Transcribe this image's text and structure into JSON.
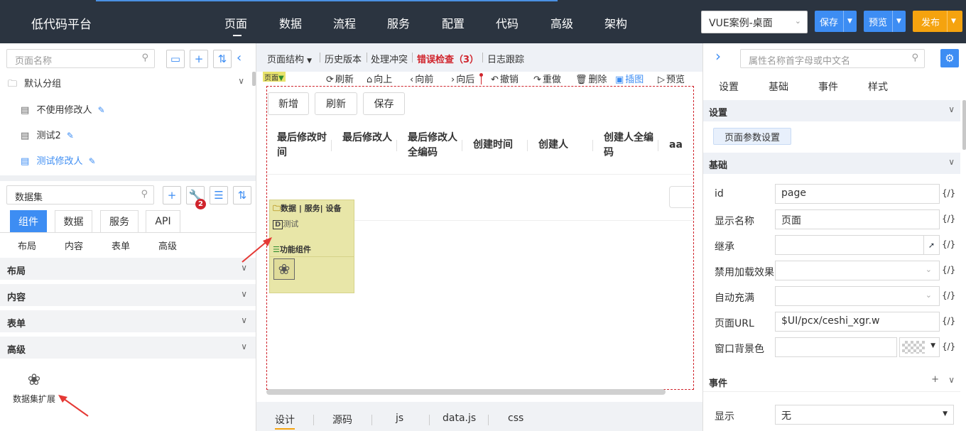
{
  "app": {
    "title": "低代码平台",
    "nav": [
      "页面",
      "数据",
      "流程",
      "服务",
      "配置",
      "代码",
      "高级",
      "架构"
    ],
    "project": "VUE案例-桌面",
    "save": "保存",
    "preview": "预览",
    "publish": "发布"
  },
  "left": {
    "page_search_placeholder": "页面名称",
    "group": "默认分组",
    "pages": [
      "不使用修改人",
      "测试2",
      "测试修改人"
    ],
    "component_search": "数据集",
    "badge": "2",
    "tabs": [
      "组件",
      "数据",
      "服务",
      "API"
    ],
    "subtabs": [
      "布局",
      "内容",
      "表单",
      "高级"
    ],
    "sections": [
      "布局",
      "内容",
      "表单",
      "高级"
    ],
    "extension_label": "数据集扩展"
  },
  "center": {
    "toolbar": [
      "页面结构",
      "历史版本",
      "处理冲突",
      "错误检查（3）",
      "日志跟踪"
    ],
    "page_tag": "页面",
    "actions": [
      "刷新",
      "向上",
      "向前",
      "向后",
      "撤销",
      "重做",
      "删除",
      "插图",
      "预览"
    ],
    "buttons": [
      "新增",
      "刷新",
      "保存"
    ],
    "columns": [
      "最后修改时间",
      "最后修改人",
      "最后修改人全编码",
      "创建时间",
      "创建人",
      "创建人全编码",
      "aa"
    ],
    "popup": {
      "header": "数据 | 服务| 设备",
      "item": "测试",
      "section": "功能组件"
    },
    "bottom_tabs": [
      "设计",
      "源码",
      "js",
      "data.js",
      "css"
    ]
  },
  "right": {
    "search_placeholder": "属性名称首字母或中文名",
    "tabs": [
      "设置",
      "基础",
      "事件",
      "样式"
    ],
    "section_settings": "设置",
    "page_param_button": "页面参数设置",
    "section_basic": "基础",
    "props": [
      {
        "label": "id",
        "value": "page"
      },
      {
        "label": "显示名称",
        "value": "页面"
      },
      {
        "label": "继承",
        "value": ""
      },
      {
        "label": "禁用加载效果",
        "value": ""
      },
      {
        "label": "自动充满",
        "value": ""
      },
      {
        "label": "页面URL",
        "value": "$UI/pcx/ceshi_xgr.w"
      },
      {
        "label": "窗口背景色",
        "value": ""
      }
    ],
    "code_tag": "{/}",
    "section_events": "事件",
    "display_label": "显示",
    "display_value": "无"
  },
  "colors": {
    "topbar": "#2b3440",
    "primary": "#3d8df3",
    "publish": "#f5a30f",
    "error": "#d0242c"
  }
}
